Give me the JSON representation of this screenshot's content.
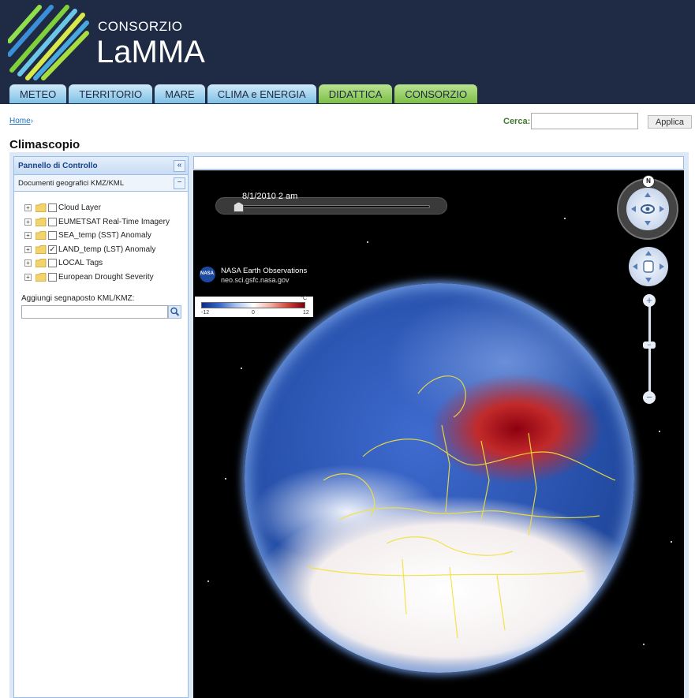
{
  "header": {
    "logo_top": "CONSORZIO",
    "logo_main": "LaMMA"
  },
  "nav": [
    {
      "label": "METEO",
      "color": "blue"
    },
    {
      "label": "TERRITORIO",
      "color": "blue"
    },
    {
      "label": "MARE",
      "color": "blue"
    },
    {
      "label": "CLIMA e ENERGIA",
      "color": "blue"
    },
    {
      "label": "DIDATTICA",
      "color": "green"
    },
    {
      "label": "CONSORZIO",
      "color": "green"
    }
  ],
  "breadcrumb": {
    "home": "Home",
    "sep": "›"
  },
  "search": {
    "label": "Cerca:",
    "value": "",
    "button": "Applica"
  },
  "page_title": "Climascopio",
  "panel": {
    "title": "Pannello di Controllo",
    "collapse_icon": "«",
    "section_title": "Documenti geografici KMZ/KML",
    "section_icon": "−",
    "layers": [
      {
        "label": "Cloud Layer",
        "checked": false
      },
      {
        "label": "EUMETSAT Real-Time Imagery",
        "checked": false
      },
      {
        "label": "SEA_temp (SST) Anomaly",
        "checked": false
      },
      {
        "label": "LAND_temp (LST) Anomaly",
        "checked": true
      },
      {
        "label": "LOCAL Tags",
        "checked": false
      },
      {
        "label": "European Drought Severity",
        "checked": false
      }
    ],
    "kml_label": "Aggiungi segnaposto KML/KMZ:",
    "kml_value": ""
  },
  "map": {
    "time_label": "8/1/2010   2 am",
    "time_progress": 0.0,
    "nasa_title": "NASA Earth Observations",
    "nasa_url": "neo.sci.gsfc.nasa.gov",
    "nasa_logo_text": "NASA",
    "legend": {
      "unit": "°C",
      "min": "-12",
      "mid": "0",
      "max": "12"
    },
    "compass_n": "N",
    "zoom_in": "+",
    "zoom_out": "−",
    "zoom_handle": "−"
  },
  "colors": {
    "header_bg": "#1f2a44",
    "tab_blue": "#9fd3f0",
    "tab_green": "#8fcb5a",
    "panel_border": "#99bbe8"
  }
}
